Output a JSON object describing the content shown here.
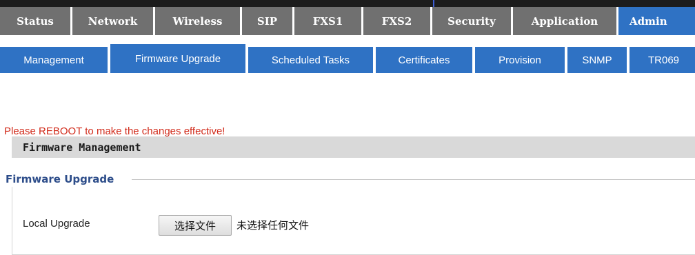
{
  "main_tabs": [
    {
      "label": "Status",
      "active": false
    },
    {
      "label": "Network",
      "active": false
    },
    {
      "label": "Wireless",
      "active": false
    },
    {
      "label": "SIP",
      "active": false
    },
    {
      "label": "FXS1",
      "active": false
    },
    {
      "label": "FXS2",
      "active": false
    },
    {
      "label": "Security",
      "active": false
    },
    {
      "label": "Application",
      "active": false
    },
    {
      "label": "Admin",
      "active": true
    }
  ],
  "sub_tabs": [
    {
      "label": "Management",
      "active": false
    },
    {
      "label": "Firmware Upgrade",
      "active": true
    },
    {
      "label": "Scheduled Tasks",
      "active": false
    },
    {
      "label": "Certificates",
      "active": false
    },
    {
      "label": "Provision",
      "active": false
    },
    {
      "label": "SNMP",
      "active": false
    },
    {
      "label": "TR069",
      "active": false
    }
  ],
  "notice": {
    "reboot_message": "Please REBOOT to make the changes effective!"
  },
  "section": {
    "title": "Firmware Management"
  },
  "fieldset": {
    "legend": "Firmware Upgrade",
    "local_upgrade": {
      "label": "Local Upgrade",
      "button_label": "选择文件",
      "status_text": "未选择任何文件"
    }
  },
  "colors": {
    "tab_inactive": "#707070",
    "tab_active": "#2f72c4",
    "notice_red": "#d12a1a",
    "legend_blue": "#2d4d8a"
  },
  "icons": []
}
